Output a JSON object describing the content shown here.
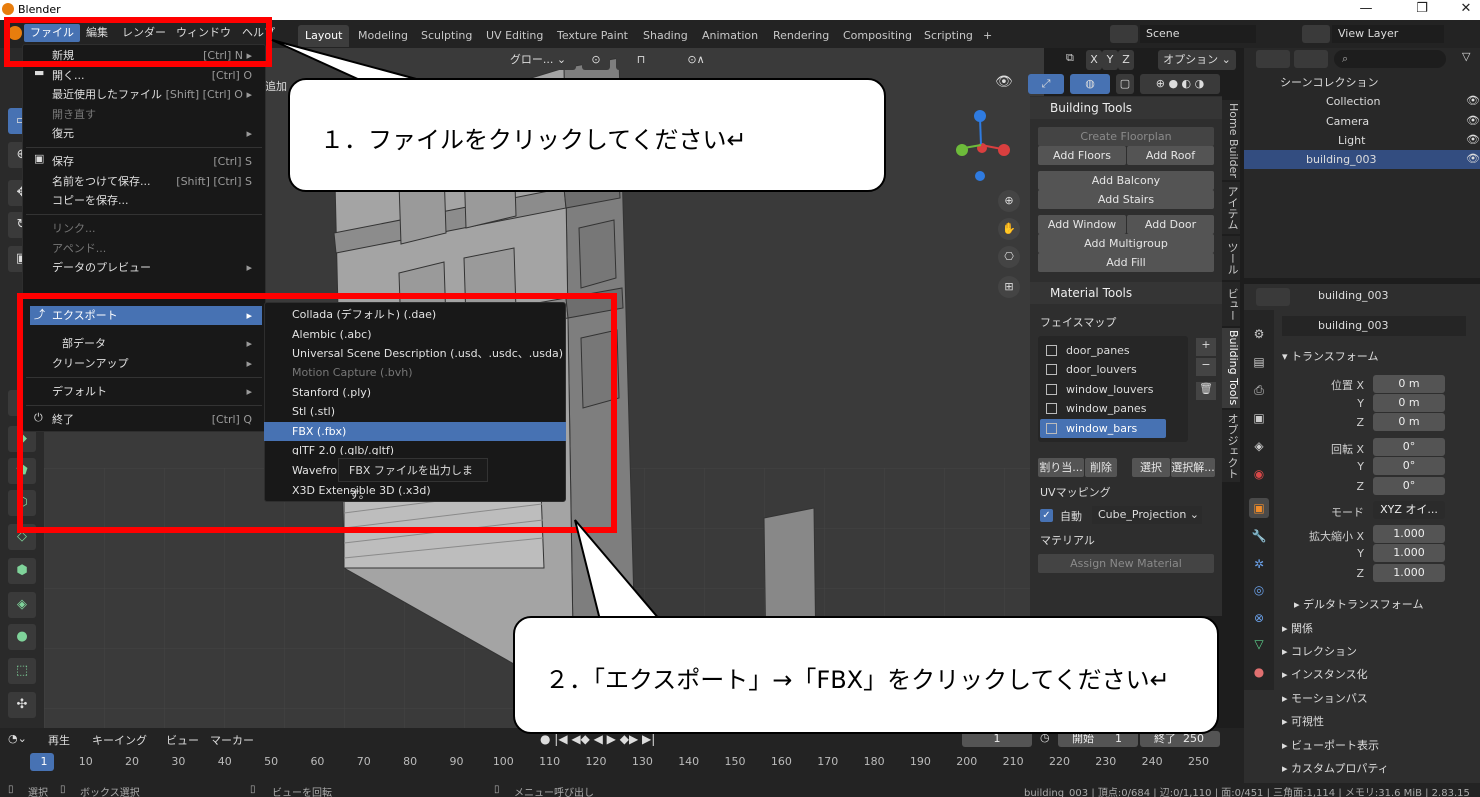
{
  "window": {
    "title": "Blender",
    "min": "—",
    "max": "❐",
    "close": "✕"
  },
  "menubar": {
    "items": [
      "ファイル",
      "編集",
      "レンダー",
      "ウィンドウ",
      "ヘルプ"
    ],
    "workspaces": [
      "Layout",
      "Modeling",
      "Sculpting",
      "UV Editing",
      "Texture Paint",
      "Shading",
      "Animation",
      "Rendering",
      "Compositing",
      "Scripting",
      "+"
    ],
    "scene": "Scene",
    "view_layer": "View Layer"
  },
  "viewport": {
    "orientation": "グロー...",
    "options": "オプション",
    "axes": [
      "X",
      "Y",
      "Z"
    ],
    "add_label": "追加"
  },
  "file_menu": {
    "items": [
      {
        "label": "新規",
        "shortcut": "[Ctrl] N ▸"
      },
      {
        "label": "開く...",
        "shortcut": "[Ctrl] O"
      },
      {
        "label": "最近使用したファイル",
        "shortcut": "[Shift] [Ctrl] O ▸"
      },
      {
        "label": "開き直す",
        "shortcut": ""
      },
      {
        "label": "復元",
        "shortcut": "▸"
      },
      {
        "label": "保存",
        "shortcut": "[Ctrl] S"
      },
      {
        "label": "名前をつけて保存...",
        "shortcut": "[Shift] [Ctrl] S"
      },
      {
        "label": "コピーを保存...",
        "shortcut": ""
      },
      {
        "label": "リンク...",
        "shortcut": ""
      },
      {
        "label": "アペンド...",
        "shortcut": ""
      },
      {
        "label": "データのプレビュー",
        "shortcut": "▸"
      },
      {
        "label": "エクスポート",
        "shortcut": "▸"
      },
      {
        "label": "部データ",
        "shortcut": "▸"
      },
      {
        "label": "クリーンアップ",
        "shortcut": "▸"
      },
      {
        "label": "デフォルト",
        "shortcut": "▸"
      },
      {
        "label": "終了",
        "shortcut": "[Ctrl] Q"
      }
    ]
  },
  "export_menu": {
    "items": [
      "Collada (デフォルト) (.dae)",
      "Alembic (.abc)",
      "Universal Scene Description (.usd、.usdc、.usda)",
      "Motion Capture (.bvh)",
      "Stanford (.ply)",
      "Stl (.stl)",
      "FBX (.fbx)",
      "glTF 2.0 (.glb/.gltf)",
      "Wavefro",
      "X3D Extensible 3D (.x3d)"
    ],
    "tooltip": "FBX ファイルを出力します。"
  },
  "building_tools": {
    "header": "Building Tools",
    "create_floorplan": "Create Floorplan",
    "add_floors": "Add Floors",
    "add_roof": "Add Roof",
    "add_balcony": "Add Balcony",
    "add_stairs": "Add Stairs",
    "add_window": "Add Window",
    "add_door": "Add Door",
    "add_multigroup": "Add Multigroup",
    "add_fill": "Add Fill",
    "material_header": "Material Tools",
    "face_map_label": "フェイスマップ",
    "face_maps": [
      "door_panes",
      "door_louvers",
      "window_louvers",
      "window_panes",
      "window_bars"
    ],
    "assign": "割り当...",
    "remove": "削除",
    "select": "選択",
    "deselect": "選択解...",
    "uv_label": "UVマッピング",
    "auto": "自動",
    "projection": "Cube_Projection",
    "material_label": "マテリアル",
    "assign_material": "Assign New Material",
    "side_tabs": [
      "Home Builder",
      "アイテム",
      "ツール",
      "ビュー",
      "Building Tools",
      "オブジェクト"
    ]
  },
  "outliner": {
    "scene_collection": "シーンコレクション",
    "collection": "Collection",
    "camera": "Camera",
    "light": "Light",
    "object": "building_003"
  },
  "properties": {
    "object_name": "building_003",
    "data_name": "building_003",
    "transform": "トランスフォーム",
    "loc_label": "位置 X",
    "loc": [
      "0 m",
      "0 m",
      "0 m"
    ],
    "rot_label": "回転 X",
    "rot": [
      "0°",
      "0°",
      "0°"
    ],
    "mode_label": "モード",
    "mode": "XYZ オイ...",
    "scale_label": "拡大縮小 X",
    "scale": [
      "1.000",
      "1.000",
      "1.000"
    ],
    "y": "Y",
    "z": "Z",
    "delta": "デルタトランスフォーム",
    "sections": [
      "関係",
      "コレクション",
      "インスタンス化",
      "モーションパス",
      "可視性",
      "ビューポート表示",
      "カスタムプロパティ"
    ]
  },
  "timeline": {
    "menus": [
      "再生",
      "キーイング",
      "ビュー",
      "マーカー"
    ],
    "current": "1",
    "start_label": "開始",
    "start": "1",
    "end_label": "終了",
    "end": "250",
    "ticks": [
      "1",
      "10",
      "20",
      "30",
      "40",
      "50",
      "60",
      "70",
      "80",
      "90",
      "100",
      "110",
      "120",
      "130",
      "140",
      "150",
      "160",
      "170",
      "180",
      "190",
      "200",
      "210",
      "220",
      "230",
      "240",
      "250"
    ]
  },
  "statusbar": {
    "select": "選択",
    "box_select": "ボックス選択",
    "rotate_view": "ビューを回転",
    "call_menu": "メニュー呼び出し",
    "stats": "building_003 | 頂点:0/684 | 辺:0/1,110 | 面:0/451 | 三角面:1,114 | メモリ:31.6 MiB | 2.83.15"
  },
  "annotations": {
    "step1": "１．ファイルをクリックしてください↵",
    "step2": "２．「エクスポート」→「FBX」をクリックしてください↵",
    "highlight_color": "#ff0000"
  }
}
